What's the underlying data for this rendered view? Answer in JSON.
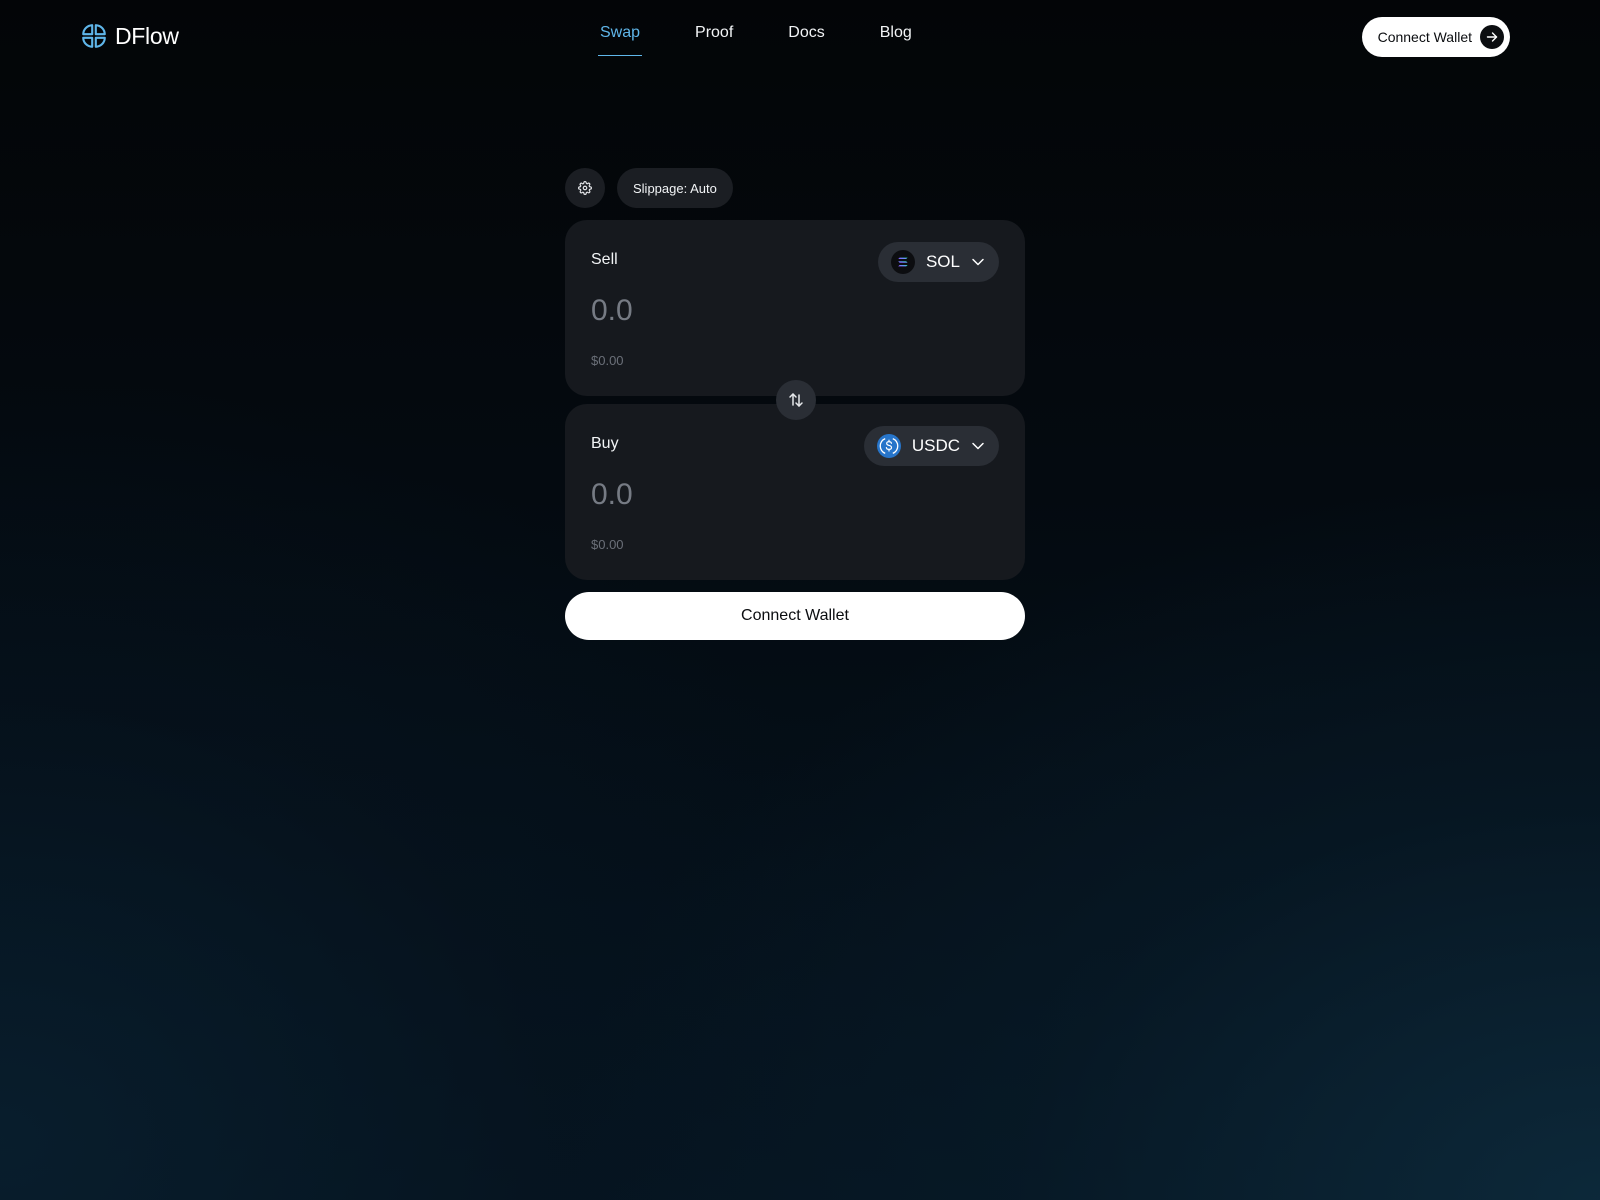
{
  "header": {
    "brand_name": "DFlow",
    "logo_icon": "dflow-logo-icon",
    "nav": [
      {
        "label": "Swap",
        "active": true
      },
      {
        "label": "Proof",
        "active": false
      },
      {
        "label": "Docs",
        "active": false
      },
      {
        "label": "Blog",
        "active": false
      }
    ],
    "connect_label": "Connect Wallet",
    "connect_icon": "arrow-right-icon"
  },
  "widget": {
    "settings_icon": "gear-icon",
    "slippage_label": "Slippage: Auto",
    "sell": {
      "label": "Sell",
      "token": "SOL",
      "token_icon": "solana-icon",
      "amount_placeholder": "0.0",
      "amount_value": "",
      "usd_value": "$0.00"
    },
    "swap_icon": "swap-arrows-icon",
    "buy": {
      "label": "Buy",
      "token": "USDC",
      "token_icon": "usdc-icon",
      "amount_placeholder": "0.0",
      "amount_value": "",
      "usd_value": "$0.00"
    },
    "connect_label": "Connect Wallet"
  },
  "colors": {
    "accent": "#5fb6ea",
    "card_bg": "#16191e",
    "pill_bg": "#2a2e35",
    "muted_text": "#6b7079",
    "button_bg": "#ffffff"
  }
}
